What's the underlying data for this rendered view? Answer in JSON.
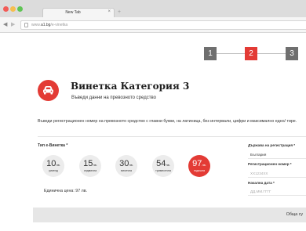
{
  "browser": {
    "tab_title": "New Tab",
    "tab_close": "×",
    "new_tab": "+",
    "url_prefix": "www.",
    "url_domain": "a1.bg",
    "url_path": "/e-vinetka"
  },
  "steps": [
    "1",
    "2",
    "3"
  ],
  "active_step": 2,
  "header": {
    "title": "Винетка Категория 3",
    "subtitle": "Въведи данни на превозното средство"
  },
  "instructions": "Въведи регистрационен номер на превозното средство с главни букви, на латиница, без интервали, цифри и максимално едно/ тире.",
  "vignette": {
    "type_label": "Тип е-Винетка *",
    "options": [
      {
        "amount": "10",
        "currency": "лв.",
        "period": "уикенд",
        "selected": false
      },
      {
        "amount": "15",
        "currency": "лв.",
        "period": "седмична",
        "selected": false
      },
      {
        "amount": "30",
        "currency": "лв.",
        "period": "месечна",
        "selected": false
      },
      {
        "amount": "54",
        "currency": "лв.",
        "period": "тримесечна",
        "selected": false
      },
      {
        "amount": "97",
        "currency": "лв.",
        "period": "годишна",
        "selected": true
      }
    ],
    "unit_price": "Единична цена: 97 лв."
  },
  "form": {
    "country_label": "Държава на регистрация *",
    "country_value": "България",
    "reg_label": "Регистрационен номер *",
    "reg_placeholder": "XX1234XX",
    "start_label": "Начална дата *",
    "start_placeholder": "ДД.ММ.ГГГГ"
  },
  "footer": {
    "total_label": "Обща су"
  },
  "colors": {
    "accent": "#e33b35",
    "step_inactive": "#6f6f6f",
    "circle_bg": "#ececec"
  }
}
